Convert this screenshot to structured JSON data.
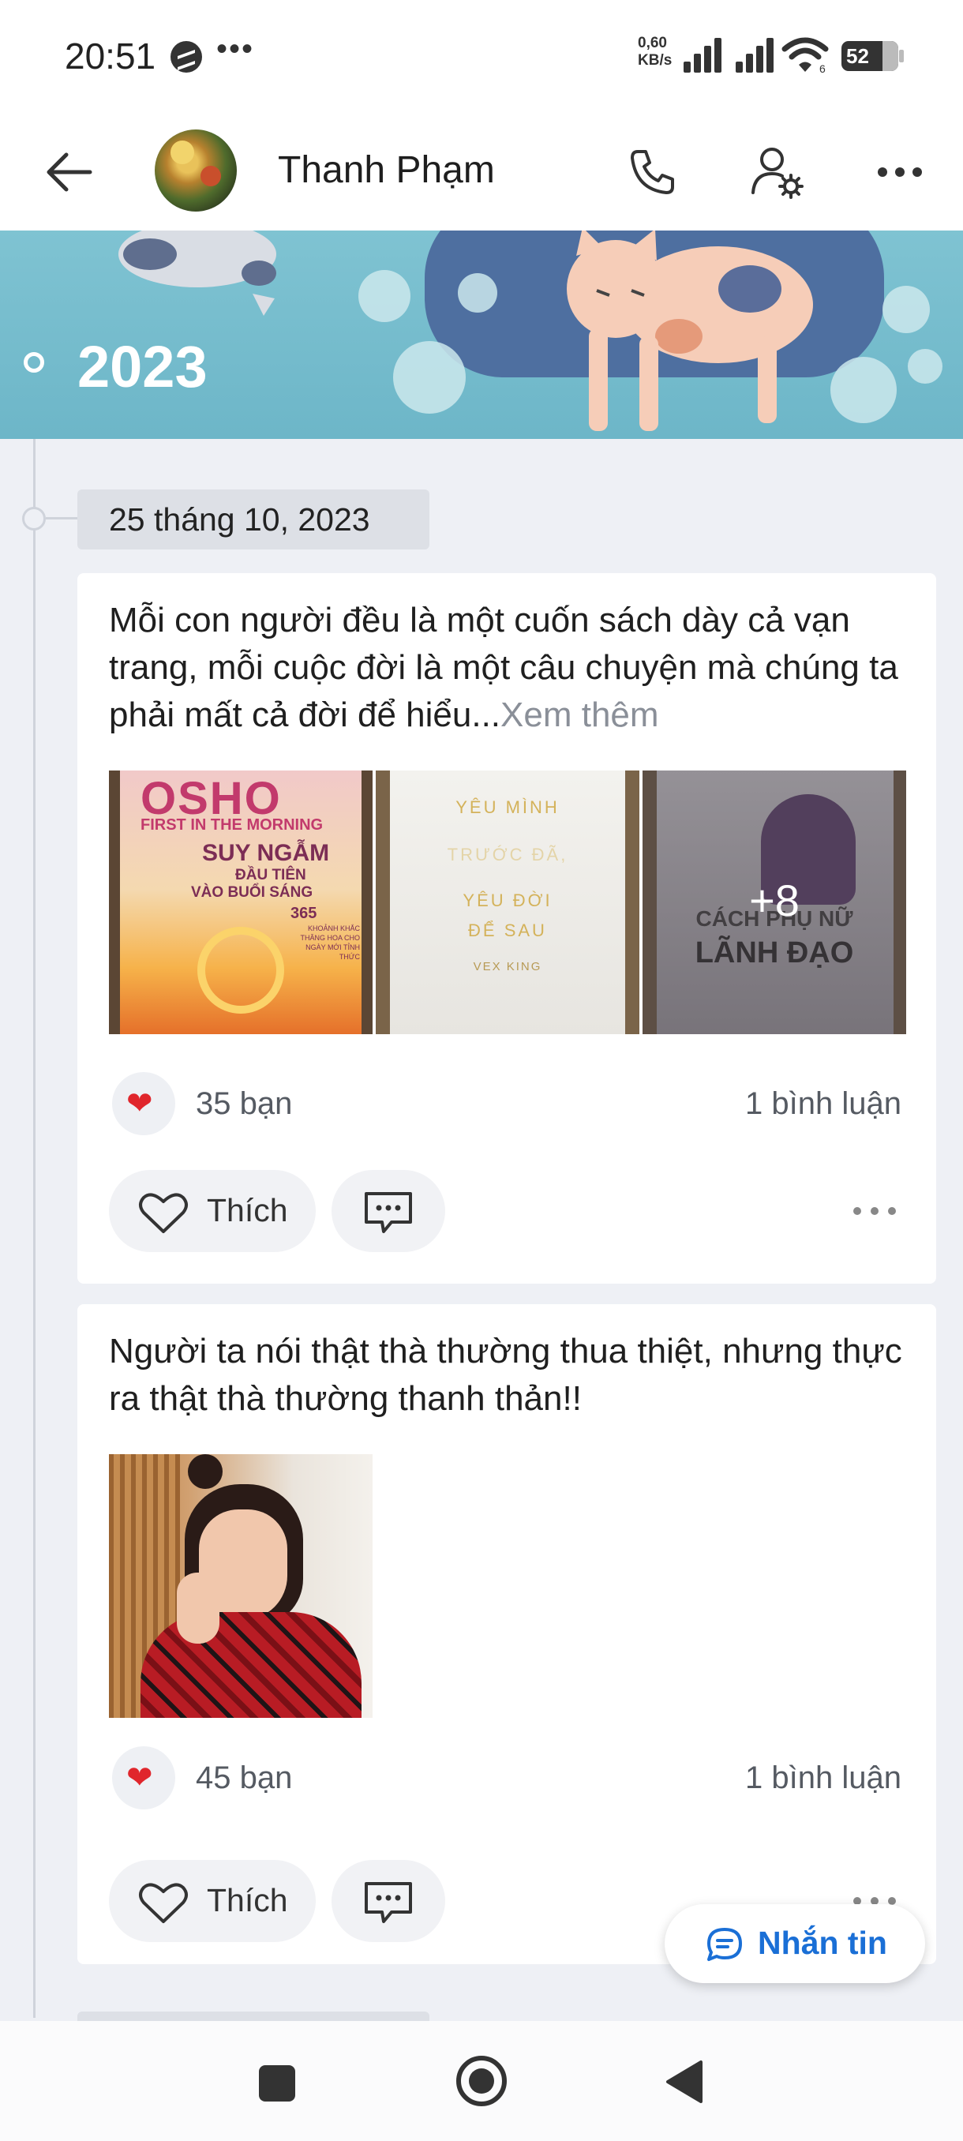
{
  "status_bar": {
    "time": "20:51",
    "speed_value": "0,60",
    "speed_unit": "KB/s",
    "battery": "52",
    "wifi_label": "6"
  },
  "header": {
    "profile_name": "Thanh Phạm"
  },
  "cover": {
    "year": "2023"
  },
  "timeline": {
    "date": "25 tháng 10, 2023"
  },
  "posts": [
    {
      "text": "Mỗi con người đều là một cuốn sách dày cả vạn trang, mỗi cuộc đời là một câu chuyện mà chúng ta phải mất cả đời để hiểu...",
      "see_more": "Xem thêm",
      "photos": [
        {
          "title_top": "OSHO",
          "title_sub": "FIRST IN THE MORNING",
          "title_main": "SUY NGẪM",
          "title_sub2": "ĐẦU TIÊN",
          "title_sub3": "VÀO BUỔI SÁNG",
          "num": "365",
          "small": "KHOẢNH KHẮC THĂNG HOA CHO NGÀY MỚI TỈNH THỨC"
        },
        {
          "line1": "YÊU MÌNH",
          "line2": "TRƯỚC ĐÃ,",
          "line3": "YÊU ĐỜI",
          "line4": "ĐỂ SAU",
          "author": "VEX KING"
        },
        {
          "line1": "CÁCH PHỤ NỮ",
          "line2": "LÃNH ĐẠO",
          "overlay": "+8"
        }
      ],
      "reaction_icon": "heart-icon",
      "reaction_count": "35 bạn",
      "comment_count": "1 bình luận",
      "like_label": "Thích"
    },
    {
      "text": "Người ta nói thật thà thường thua thiệt, nhưng thực ra thật thà thường thanh thản!!",
      "reaction_icon": "heart-icon",
      "reaction_count": "45 bạn",
      "comment_count": "1 bình luận",
      "like_label": "Thích"
    }
  ],
  "fab": {
    "label": "Nhắn tin"
  },
  "colors": {
    "accent": "#1a6fd6",
    "heart": "#e0262c",
    "background": "#eef0f5"
  }
}
